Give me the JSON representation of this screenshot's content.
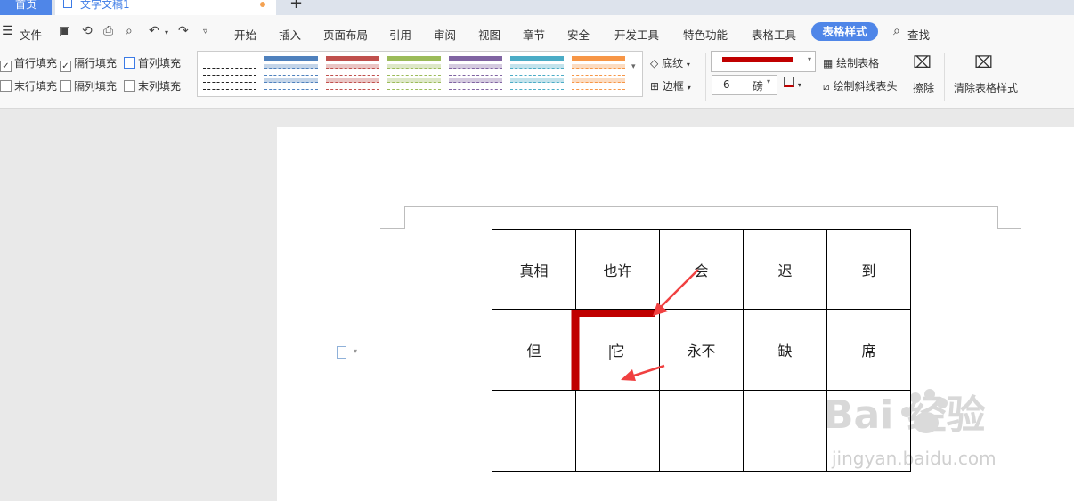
{
  "tabs": {
    "home": "首页",
    "doc": "文字文稿1",
    "add": "+"
  },
  "menu": {
    "file": "文件",
    "items": [
      "开始",
      "插入",
      "页面布局",
      "引用",
      "审阅",
      "视图",
      "章节",
      "安全",
      "开发工具",
      "特色功能",
      "表格工具",
      "表格样式"
    ],
    "active": "表格样式",
    "search": "查找"
  },
  "ribbon": {
    "checks": [
      {
        "label": "首行填充",
        "checked": true
      },
      {
        "label": "隔行填充",
        "checked": true
      },
      {
        "label": "首列填充",
        "checked": false
      },
      {
        "label": "末行填充",
        "checked": false
      },
      {
        "label": "隔列填充",
        "checked": false
      },
      {
        "label": "末列填充",
        "checked": false
      }
    ],
    "shading": "底纹",
    "border": "边框",
    "line_color": "#c00000",
    "line_width": "6",
    "unit": "磅",
    "draw_table": "绘制表格",
    "draw_diagonal": "绘制斜线表头",
    "erase": "擦除",
    "clear_style": "清除表格样式",
    "gallery_colors": [
      "#333333",
      "#4f81bd",
      "#c0504d",
      "#9bbb59",
      "#8064a2",
      "#4bacc6",
      "#f79646"
    ]
  },
  "table": {
    "rows": [
      [
        "真相",
        "也许",
        "会",
        "迟",
        "到"
      ],
      [
        "但",
        "它",
        "永不",
        "缺",
        "席"
      ],
      [
        "",
        "",
        "",
        "",
        ""
      ]
    ]
  },
  "annotation_color": "#c00000",
  "arrow_color": "#f04040",
  "watermark": {
    "brand": "Bai  经验",
    "url": "jingyan.baidu.com"
  }
}
